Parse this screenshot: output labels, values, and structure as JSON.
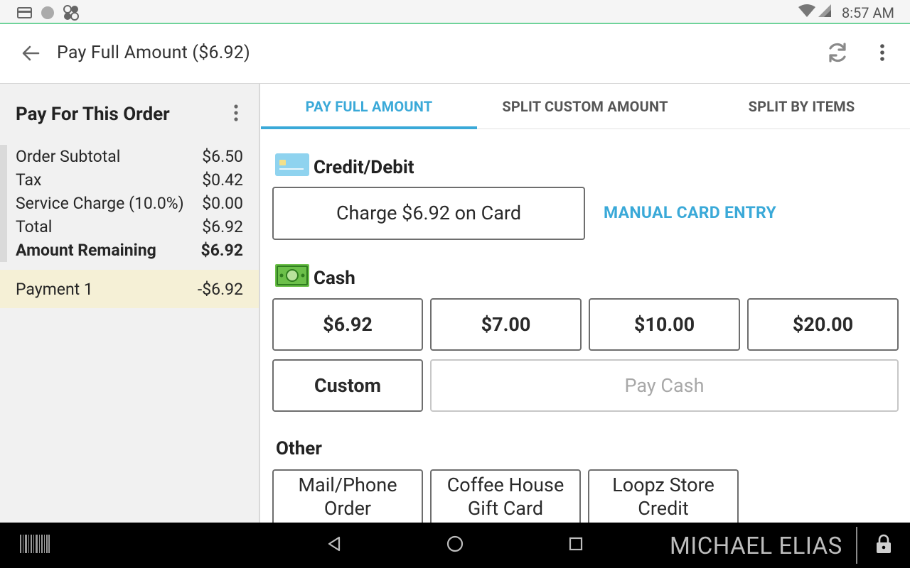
{
  "status_bar": {
    "time": "8:57 AM",
    "icons": [
      "card-reader-icon",
      "circle-status-icon",
      "clover-icon",
      "wifi-icon",
      "cellular-signal-icon"
    ]
  },
  "app_bar": {
    "title": "Pay Full Amount ($6.92)",
    "icons": [
      "back-arrow-icon",
      "refresh-icon",
      "more-vert-icon"
    ]
  },
  "order_summary": {
    "title": "Pay For This Order",
    "rows": [
      {
        "label": "Order Subtotal",
        "value": "$6.50"
      },
      {
        "label": "Tax",
        "value": "$0.42"
      },
      {
        "label": "Service Charge (10.0%)",
        "value": "$0.00"
      },
      {
        "label": "Total",
        "value": "$6.92"
      },
      {
        "label": "Amount Remaining",
        "value": "$6.92"
      }
    ],
    "payment": {
      "label": "Payment 1",
      "value": "-$6.92"
    }
  },
  "tabs": [
    {
      "label": "PAY FULL AMOUNT",
      "active": true
    },
    {
      "label": "SPLIT CUSTOM AMOUNT",
      "active": false
    },
    {
      "label": "SPLIT BY ITEMS",
      "active": false
    }
  ],
  "credit_debit": {
    "heading": "Credit/Debit",
    "charge_button": "Charge $6.92 on Card",
    "manual_entry": "MANUAL CARD ENTRY"
  },
  "cash": {
    "heading": "Cash",
    "amounts": [
      "$6.92",
      "$7.00",
      "$10.00",
      "$20.00"
    ],
    "custom_button": "Custom",
    "pay_cash_button": "Pay Cash"
  },
  "other": {
    "heading": "Other",
    "buttons": [
      "Mail/Phone\nOrder",
      "Coffee House\nGift Card",
      "Loopz Store\nCredit"
    ]
  },
  "nav_bar": {
    "user_name": "MICHAEL ELIAS",
    "icons": [
      "barcode-icon",
      "nav-back-icon",
      "nav-home-icon",
      "nav-recents-icon",
      "lock-icon"
    ]
  },
  "colors": {
    "accent": "#3aa9d8",
    "status_divider": "#6fd39a",
    "payment_highlight": "#f5f0d6"
  }
}
